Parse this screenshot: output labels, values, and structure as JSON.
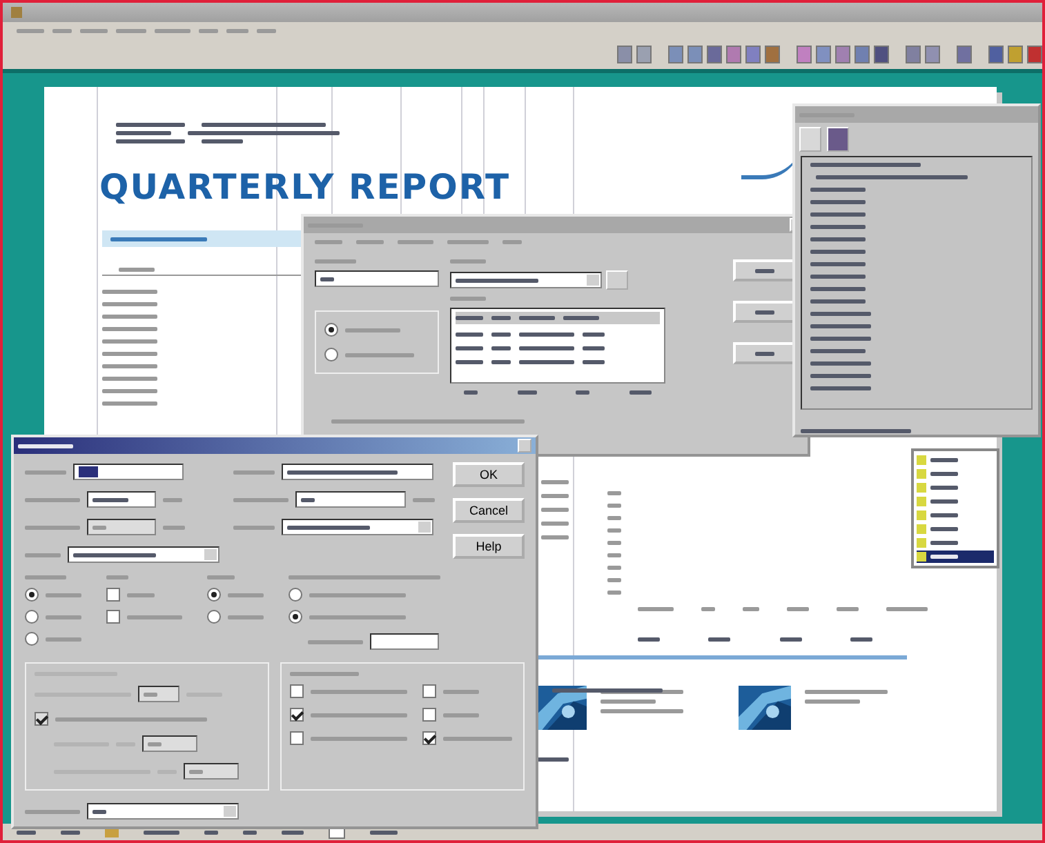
{
  "report": {
    "title": "QUARTERLY REPORT"
  },
  "file_type_options": [
    {
      "selected": true
    },
    {
      "selected": false
    }
  ],
  "font_dialog": {
    "buttons": [
      "OK",
      "Cancel",
      "Help"
    ],
    "encoding_options": [
      {
        "selected": true
      },
      {
        "selected": false
      },
      {
        "selected": false
      }
    ],
    "style_options": [
      {
        "checked": false
      },
      {
        "checked": false
      }
    ],
    "output_options": [
      {
        "selected": true
      },
      {
        "selected": false
      }
    ],
    "spacing_options": [
      {
        "selected": false
      },
      {
        "selected": true
      }
    ],
    "layout_option": {
      "checked": true
    },
    "misc_options": [
      {
        "checked": false
      },
      {
        "checked": false
      },
      {
        "checked": true
      },
      {
        "checked": false
      },
      {
        "checked": false
      },
      {
        "checked": true
      }
    ]
  },
  "legend_list": [
    {
      "selected": false
    },
    {
      "selected": false
    },
    {
      "selected": false
    },
    {
      "selected": false
    },
    {
      "selected": false
    },
    {
      "selected": false
    },
    {
      "selected": false
    },
    {
      "selected": true
    }
  ]
}
